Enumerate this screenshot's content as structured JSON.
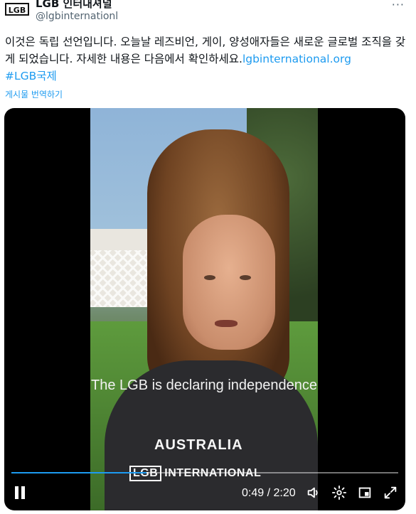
{
  "author": {
    "logo_text": "LGB",
    "display_name": "LGB 인터내셔널",
    "handle": "@lgbinternationl"
  },
  "tweet": {
    "text_part1": "이것은 독립 선언입니다. 오늘날 레즈비언, 게이, 양성애자들은 새로운 글로벌 조직을 갖게 되었습니다. 자세한 내용은 다음에서 확인하세요.",
    "link": "lgbinternational.org",
    "hashtag": "#LGB국제",
    "translate_label": "게시물 번역하기"
  },
  "video": {
    "caption": "The LGB is declaring independence",
    "shirt_text_line1": "AUSTRALIA",
    "shirt_text_logo": "LGB",
    "shirt_text_line2": "INTERNATIONAL",
    "current_time": "0:49",
    "duration": "2:20",
    "time_display": "0:49 / 2:20",
    "progress_fraction": 0.35
  },
  "icons": {
    "more": "more-icon",
    "pause": "pause-icon",
    "volume": "volume-icon",
    "settings": "gear-icon",
    "pip": "picture-in-picture-icon",
    "fullscreen": "fullscreen-icon"
  },
  "colors": {
    "link": "#1d9bf0",
    "text": "#0f1419",
    "muted": "#536471",
    "video_bg": "#000000"
  }
}
